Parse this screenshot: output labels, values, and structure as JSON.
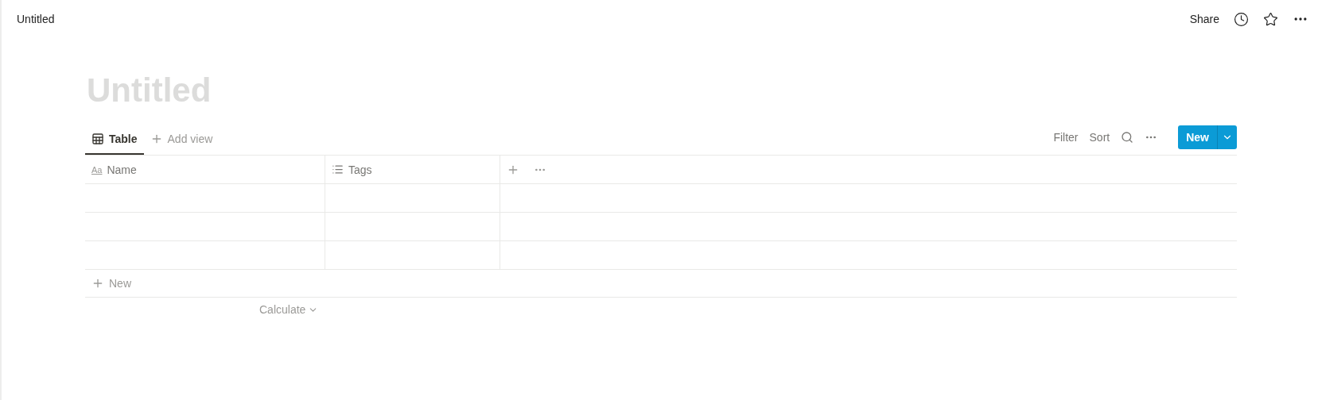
{
  "topbar": {
    "breadcrumb": "Untitled",
    "share": "Share"
  },
  "page": {
    "title": "Untitled",
    "title_empty": true
  },
  "views": [
    {
      "label": "Table",
      "selected": true,
      "kind": "table"
    },
    {
      "label": "Add view",
      "selected": false,
      "kind": "add"
    }
  ],
  "toolbar": {
    "filter": "Filter",
    "sort": "Sort",
    "new_button": "New"
  },
  "table": {
    "columns": [
      {
        "label": "Name",
        "kind": "text",
        "type_glyph": "Aa"
      },
      {
        "label": "Tags",
        "kind": "list"
      }
    ],
    "rows": [
      {
        "kind": "empty"
      },
      {
        "kind": "empty"
      },
      {
        "kind": "empty"
      }
    ],
    "new_row": "New",
    "calculate": "Calculate"
  }
}
